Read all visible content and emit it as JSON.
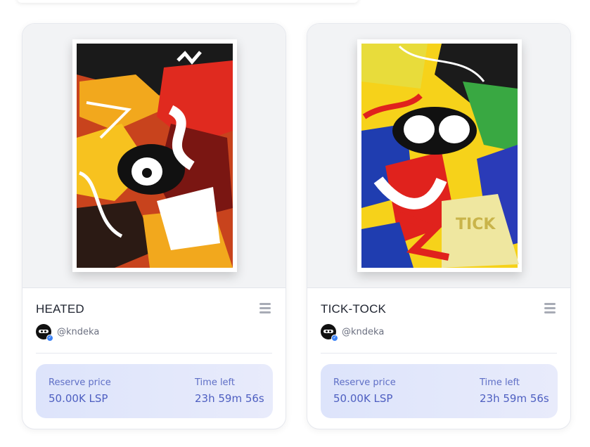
{
  "cards": [
    {
      "title": "HEATED",
      "creator_handle": "@kndeka",
      "reserve_label": "Reserve price",
      "reserve_value": "50.00K LSP",
      "time_label": "Time left",
      "time_value": "23h 59m 56s",
      "icons": {
        "menu": "menu-icon",
        "avatar": "avatar",
        "verified": "verified-badge-icon"
      }
    },
    {
      "title": "TICK-TOCK",
      "creator_handle": "@kndeka",
      "reserve_label": "Reserve price",
      "reserve_value": "50.00K LSP",
      "time_label": "Time left",
      "time_value": "23h 59m 56s",
      "icons": {
        "menu": "menu-icon",
        "avatar": "avatar",
        "verified": "verified-badge-icon"
      }
    }
  ],
  "colors": {
    "accent_text": "#4e5fc1",
    "price_box_bg": "#dde4fb",
    "muted_icon": "#a7abb5",
    "verified": "#3b82f6"
  }
}
